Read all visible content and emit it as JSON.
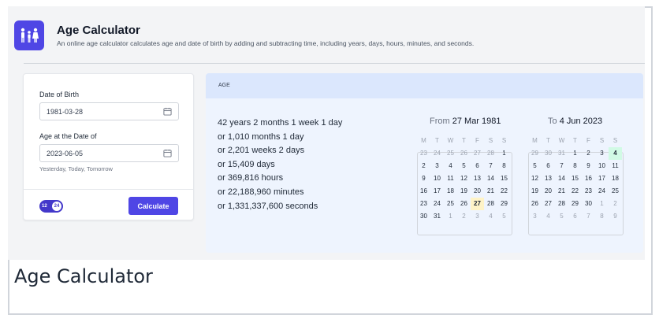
{
  "header": {
    "title": "Age Calculator",
    "description": "An online age calculator calculates age and date of birth by adding and subtracting time, including years, days, hours, minutes, and seconds.",
    "logo_icon": "family-icon",
    "logo_color": "#4f46e5"
  },
  "form": {
    "dob_label": "Date of Birth",
    "dob_value": "1981-03-28",
    "age_label": "Age at the Date of",
    "age_value": "2023-06-05",
    "hint": "Yesterday, Today, Tomorrow",
    "toggle_left": "12",
    "toggle_right": "24",
    "calculate_label": "Calculate"
  },
  "result": {
    "section_label": "AGE",
    "lines": [
      "42 years 2 months 1 week 1 day",
      "or 1,010 months 1 day",
      "or 2,201 weeks 2 days",
      "or 15,409 days",
      "or 369,816 hours",
      "or 22,188,960 minutes",
      "or 1,331,337,600 seconds"
    ]
  },
  "calendars": [
    {
      "prefix": "From",
      "date": "27 Mar 1981",
      "weekdays": [
        "M",
        "T",
        "W",
        "T",
        "F",
        "S",
        "S"
      ],
      "days": [
        [
          "23",
          "24",
          "25",
          "26",
          "27",
          "28",
          "1"
        ],
        [
          "2",
          "3",
          "4",
          "5",
          "6",
          "7",
          "8"
        ],
        [
          "9",
          "10",
          "11",
          "12",
          "13",
          "14",
          "15"
        ],
        [
          "16",
          "17",
          "18",
          "19",
          "20",
          "21",
          "22"
        ],
        [
          "23",
          "24",
          "25",
          "26",
          "27",
          "28",
          "29"
        ],
        [
          "30",
          "31",
          "1",
          "2",
          "3",
          "4",
          "5"
        ]
      ],
      "highlight": "27",
      "highlight_color": "#fef3c7"
    },
    {
      "prefix": "To",
      "date": "4 Jun 2023",
      "weekdays": [
        "M",
        "T",
        "W",
        "T",
        "F",
        "S",
        "S"
      ],
      "days": [
        [
          "29",
          "30",
          "31",
          "1",
          "2",
          "3",
          "4"
        ],
        [
          "5",
          "6",
          "7",
          "8",
          "9",
          "10",
          "11"
        ],
        [
          "12",
          "13",
          "14",
          "15",
          "16",
          "17",
          "18"
        ],
        [
          "19",
          "20",
          "21",
          "22",
          "23",
          "24",
          "25"
        ],
        [
          "26",
          "27",
          "28",
          "29",
          "30",
          "1",
          "2"
        ],
        [
          "3",
          "4",
          "5",
          "6",
          "7",
          "8",
          "9"
        ]
      ],
      "highlight": "4",
      "highlight_color": "#d1fae5"
    }
  ],
  "footer": {
    "title": "Age Calculator"
  }
}
